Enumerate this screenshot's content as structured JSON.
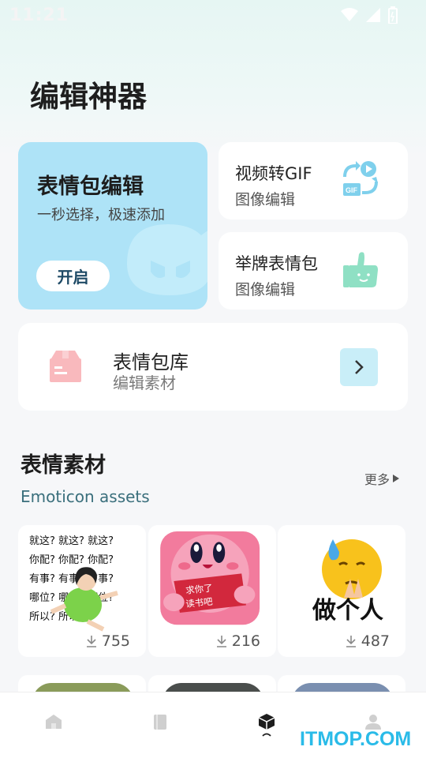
{
  "status_bar": {
    "time": "11:21",
    "icons": [
      "wifi-icon",
      "signal-icon",
      "battery-icon"
    ]
  },
  "page": {
    "title": "编辑神器"
  },
  "cards": {
    "emoji_edit": {
      "title": "表情包编辑",
      "subtitle": "一秒选择，极速添加",
      "button": "开启",
      "color": "#aee3f7"
    },
    "video_gif": {
      "title": "视频转GIF",
      "subtitle": "图像编辑",
      "icon": "video-to-gif-icon"
    },
    "sign_emoji": {
      "title": "举牌表情包",
      "subtitle": "图像编辑",
      "icon": "thumbs-up-icon"
    },
    "library": {
      "title": "表情包库",
      "subtitle": "编辑素材",
      "icon": "box-icon"
    }
  },
  "section": {
    "title": "表情素材",
    "subtitle": "Emoticon assets",
    "more": "更多"
  },
  "assets": [
    {
      "name": "就这你配有事哪位所以",
      "lines": [
        "就这? 就这? 就这?",
        "你配? 你配? 你配?",
        "有事? 有事? 有事?",
        "哪位? 哪位? 哪位?",
        "所以?           所以?"
      ],
      "downloads": "755"
    },
    {
      "name": "求你了读书吧",
      "lines": [
        "求你了",
        "读书吧"
      ],
      "downloads": "216"
    },
    {
      "name": "做个人",
      "lines": [
        "做个人"
      ],
      "downloads": "487"
    }
  ],
  "bottom_nav": [
    {
      "id": "home",
      "icon": "home-icon"
    },
    {
      "id": "book",
      "icon": "book-icon"
    },
    {
      "id": "cube",
      "icon": "cube-icon",
      "active": true
    },
    {
      "id": "profile",
      "icon": "profile-icon"
    }
  ],
  "watermark": "ITMOP.COM"
}
